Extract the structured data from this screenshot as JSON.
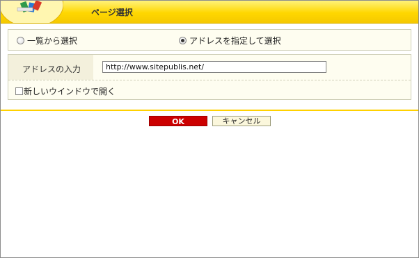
{
  "header": {
    "title": "ページ選択"
  },
  "selection": {
    "options": [
      {
        "label": "一覧から選択",
        "checked": false
      },
      {
        "label": "アドレスを指定して選択",
        "checked": true
      }
    ]
  },
  "address": {
    "label": "アドレスの入力",
    "value": "http://www.sitepublis.net/"
  },
  "new_window": {
    "label": "新しいウインドウで開く",
    "checked": false
  },
  "buttons": {
    "ok": "OK",
    "cancel": "キャンセル"
  },
  "colors": {
    "header": "#ffd700",
    "ok_button": "#cc0000",
    "panel_bg": "#fefdf0"
  }
}
